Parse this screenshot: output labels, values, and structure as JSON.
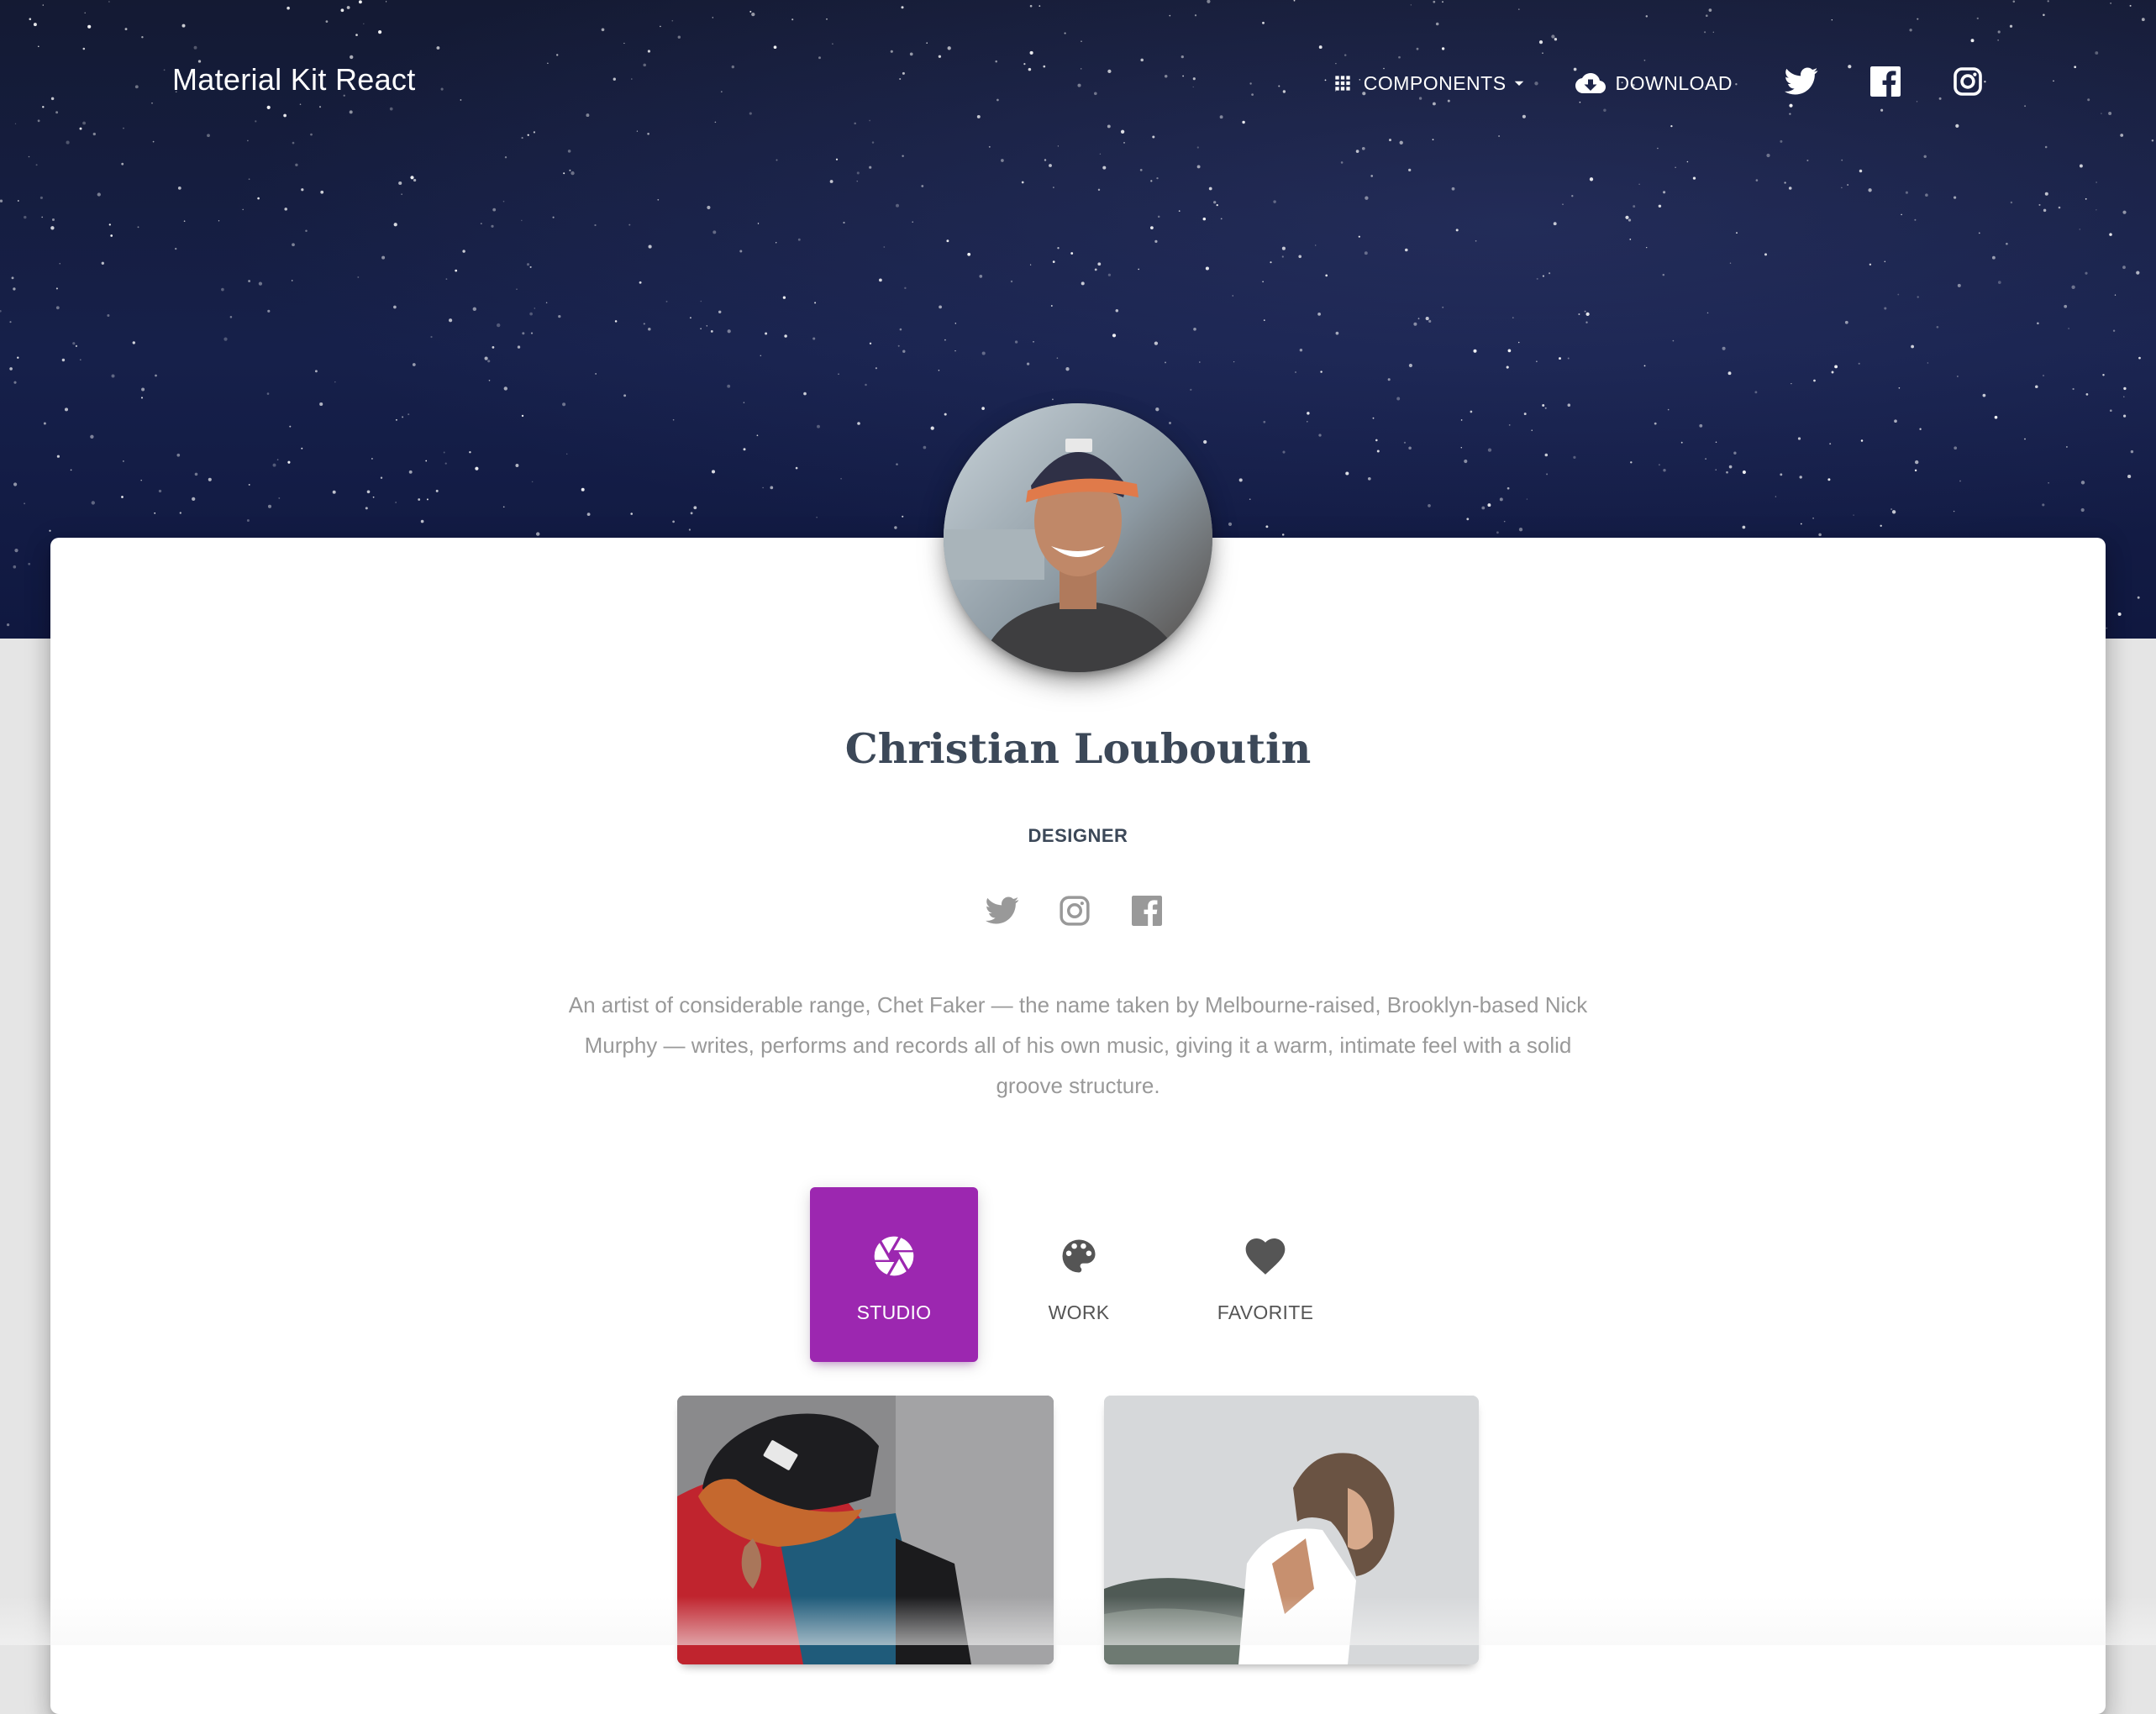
{
  "navbar": {
    "brand": "Material Kit React",
    "components_label": "COMPONENTS",
    "download_label": "DOWNLOAD",
    "icons": [
      "apps-icon",
      "chevron-down-icon",
      "cloud-download-icon",
      "twitter-icon",
      "facebook-icon",
      "instagram-icon"
    ]
  },
  "profile": {
    "name": "Christian Louboutin",
    "title": "DESIGNER",
    "social_icons": [
      "twitter-icon",
      "instagram-icon",
      "facebook-icon"
    ],
    "bio": "An artist of considerable range, Chet Faker — the name taken by Melbourne-raised, Brooklyn-based Nick Murphy — writes, performs and records all of his own music, giving it a warm, intimate feel with a solid groove structure."
  },
  "tabs": [
    {
      "label": "STUDIO",
      "icon": "camera-aperture-icon",
      "active": true
    },
    {
      "label": "WORK",
      "icon": "palette-icon",
      "active": false
    },
    {
      "label": "FAVORITE",
      "icon": "heart-icon",
      "active": false
    }
  ],
  "colors": {
    "accent": "#9c27b0",
    "title_text": "#3c4858",
    "muted_text": "#999999",
    "hero_bg": "#16204a"
  }
}
